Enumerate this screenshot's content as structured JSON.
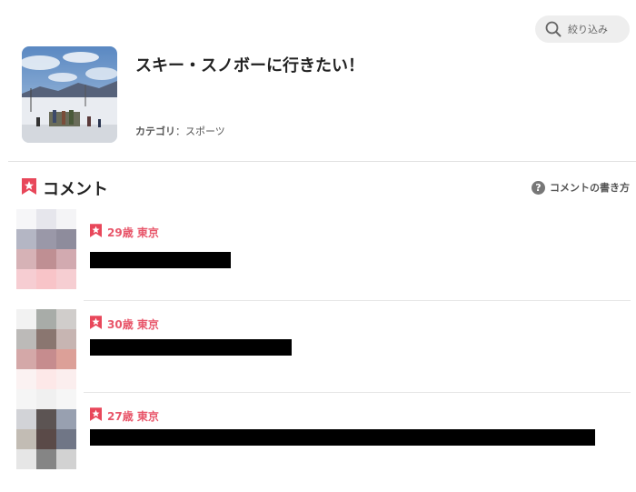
{
  "filter": {
    "label": "絞り込み",
    "icon": "search-icon"
  },
  "topic": {
    "title": "スキー・スノボーに行きたい！",
    "category_label": "カテゴリ",
    "category_sep": "：",
    "category_value": "スポーツ",
    "image": "ski-slope-photo"
  },
  "comments_section": {
    "title": "コメント",
    "howto_icon": "?",
    "howto_label": "コメントの書き方"
  },
  "comments": [
    {
      "meta": "29歳 東京",
      "redacted": true
    },
    {
      "meta": "30歳 東京",
      "redacted": true
    },
    {
      "meta": "27歳 東京",
      "redacted": true
    }
  ],
  "colors": {
    "accent": "#e8566a",
    "bookmark": "#e8475a"
  }
}
